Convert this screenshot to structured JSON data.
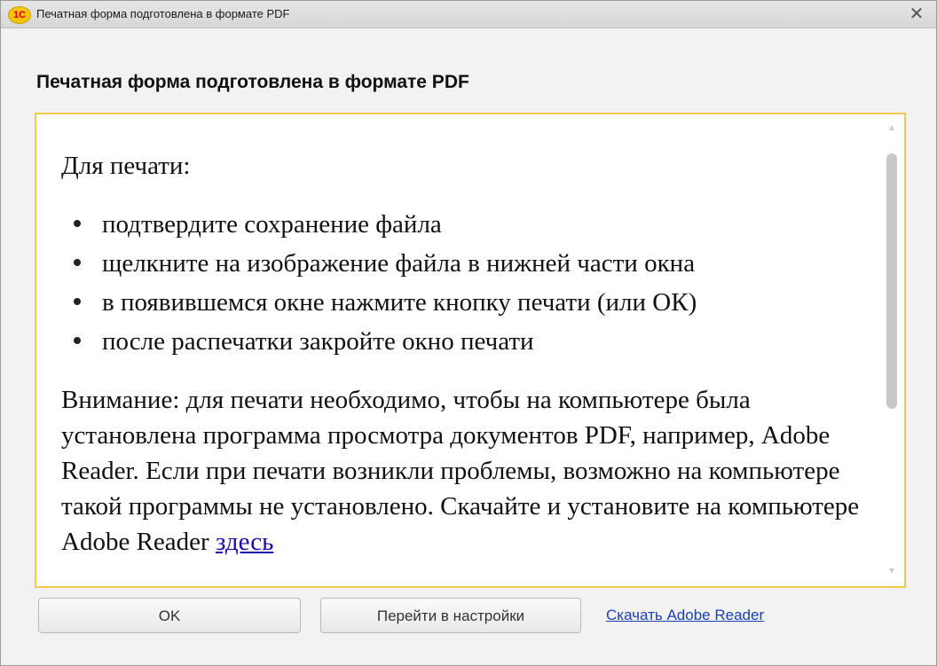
{
  "window": {
    "title": "Печатная форма подготовлена в формате PDF",
    "logo_text": "1С",
    "close_glyph": "✕"
  },
  "heading": "Печатная форма подготовлена в формате PDF",
  "content": {
    "intro": "Для печати:",
    "steps": [
      "подтвердите сохранение файла",
      "щелкните на изображение файла в нижней части окна",
      "в появившемся окне нажмите кнопку печати (или ОК)",
      "после распечатки закройте окно печати"
    ],
    "warning": "Внимание: для печати необходимо, чтобы на компьютере была установлена программа просмотра документов PDF, например, Adobe Reader. Если при печати возникли проблемы, возможно на компьютере такой программы не установлено. Скачайте и установите на компьютере Adobe Reader ",
    "warning_link": "здесь"
  },
  "buttons": {
    "ok": "OK",
    "settings": "Перейти в настройки",
    "download_link": "Скачать Adobe Reader"
  },
  "colors": {
    "frame_border": "#f2c94c",
    "link": "#1a3fb8",
    "logo": "#f6c400"
  },
  "icons": {
    "logo": "1c-logo-icon",
    "close": "close-icon"
  }
}
